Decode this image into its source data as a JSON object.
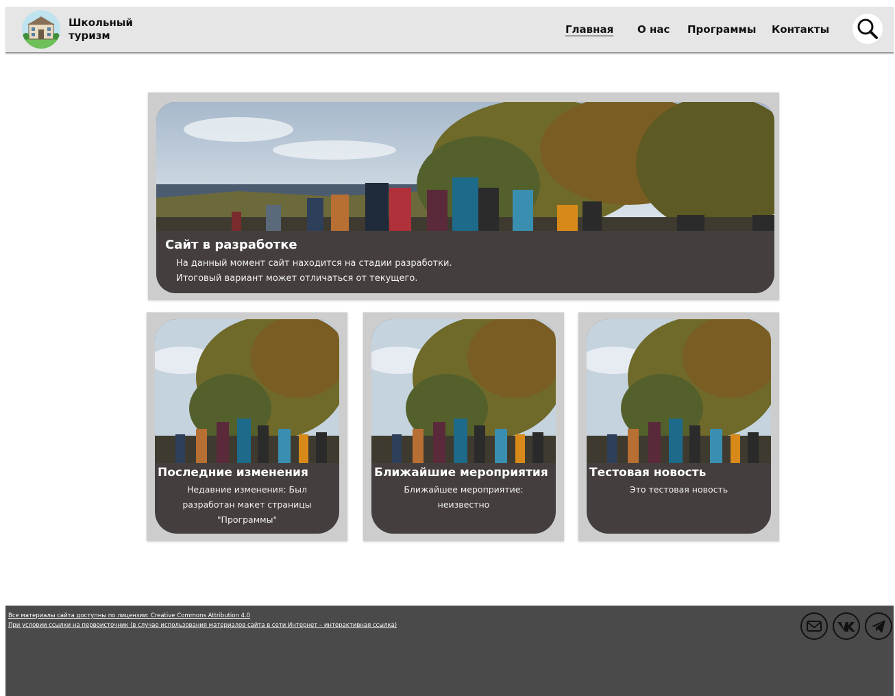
{
  "header": {
    "brand_line1": "Школьный",
    "brand_line2": "туризм",
    "nav": [
      {
        "label": "Главная",
        "active": true
      },
      {
        "label": "О нас",
        "active": false
      },
      {
        "label": "Программы",
        "active": false
      },
      {
        "label": "Контакты",
        "active": false
      }
    ],
    "search_icon": "search-icon"
  },
  "hero": {
    "title": "Сайт в разработке",
    "lines": [
      "На данный момент сайт находится на стадии разработки.",
      "Итоговый вариант может отличаться от текущего."
    ]
  },
  "cards": [
    {
      "title": "Последние изменения",
      "body": "Недавние изменения: Был разработан макет страницы \"Программы\""
    },
    {
      "title": "Ближайшие мероприятия",
      "body": "Ближайшее мероприятие: неизвестно"
    },
    {
      "title": "Тестовая новость",
      "body": "Это тестовая новость"
    }
  ],
  "footer": {
    "line1": "Все материалы сайта доступны по лицензии: Creative Commons Attribution 4.0",
    "line2": "При условии ссылки на первоисточник (в случае использования материалов сайта в сети Интернет – интерактивная ссылка)",
    "social": [
      "mail-icon",
      "vk-icon",
      "telegram-icon"
    ]
  },
  "colors": {
    "header_bg": "#e6e6e6",
    "card_panel": "#443f3e",
    "card_frame": "#cdcdcd",
    "footer_bg": "#4a4a4a"
  }
}
